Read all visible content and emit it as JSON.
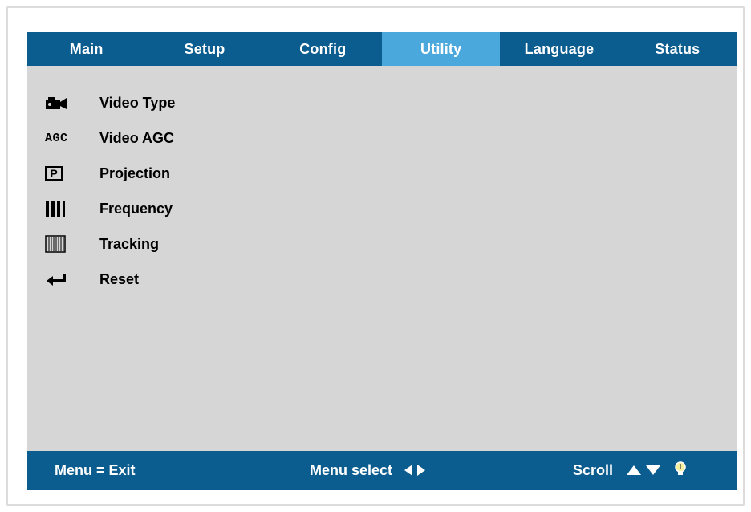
{
  "tabs": [
    {
      "label": "Main",
      "active": false
    },
    {
      "label": "Setup",
      "active": false
    },
    {
      "label": "Config",
      "active": false
    },
    {
      "label": "Utility",
      "active": true
    },
    {
      "label": "Language",
      "active": false
    },
    {
      "label": "Status",
      "active": false
    }
  ],
  "menu": {
    "items": [
      {
        "label": "Video Type",
        "icon": "camera-icon"
      },
      {
        "label": "Video AGC",
        "icon": "agc-icon",
        "icon_text": "AGC"
      },
      {
        "label": "Projection",
        "icon": "projection-icon",
        "icon_text": "P"
      },
      {
        "label": "Frequency",
        "icon": "frequency-icon"
      },
      {
        "label": "Tracking",
        "icon": "tracking-icon"
      },
      {
        "label": "Reset",
        "icon": "reset-arrow-icon"
      }
    ]
  },
  "footer": {
    "exit_label": "Menu = Exit",
    "select_label": "Menu select",
    "scroll_label": "Scroll"
  },
  "colors": {
    "bar": "#0b5c8f",
    "active_tab": "#4ba8dd",
    "panel": "#d6d6d6"
  }
}
